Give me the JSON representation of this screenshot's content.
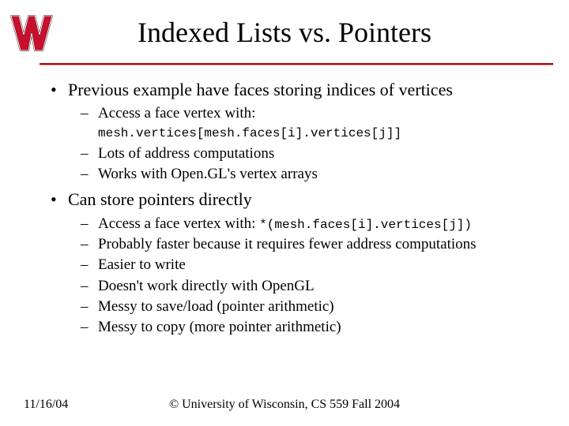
{
  "title": "Indexed Lists vs. Pointers",
  "bullet1": {
    "text": "Previous example have faces storing indices of vertices",
    "subs": {
      "a_lead": "Access a face vertex with: ",
      "a_code": "mesh.vertices[mesh.faces[i].vertices[j]]",
      "b": "Lots of address computations",
      "c": "Works with Open.GL's vertex arrays"
    }
  },
  "bullet2": {
    "text": "Can store pointers directly",
    "subs": {
      "a_lead": "Access a face vertex with: ",
      "a_code": "*(mesh.faces[i].vertices[j])",
      "b": "Probably faster because it requires fewer address computations",
      "c": "Easier to write",
      "d": "Doesn't work directly with OpenGL",
      "e": "Messy to save/load (pointer arithmetic)",
      "f": "Messy to copy (more pointer arithmetic)"
    }
  },
  "footer": {
    "date": "11/16/04",
    "copyright": "© University of Wisconsin, CS 559 Fall 2004"
  },
  "logo": {
    "name": "wisconsin-w-logo"
  }
}
